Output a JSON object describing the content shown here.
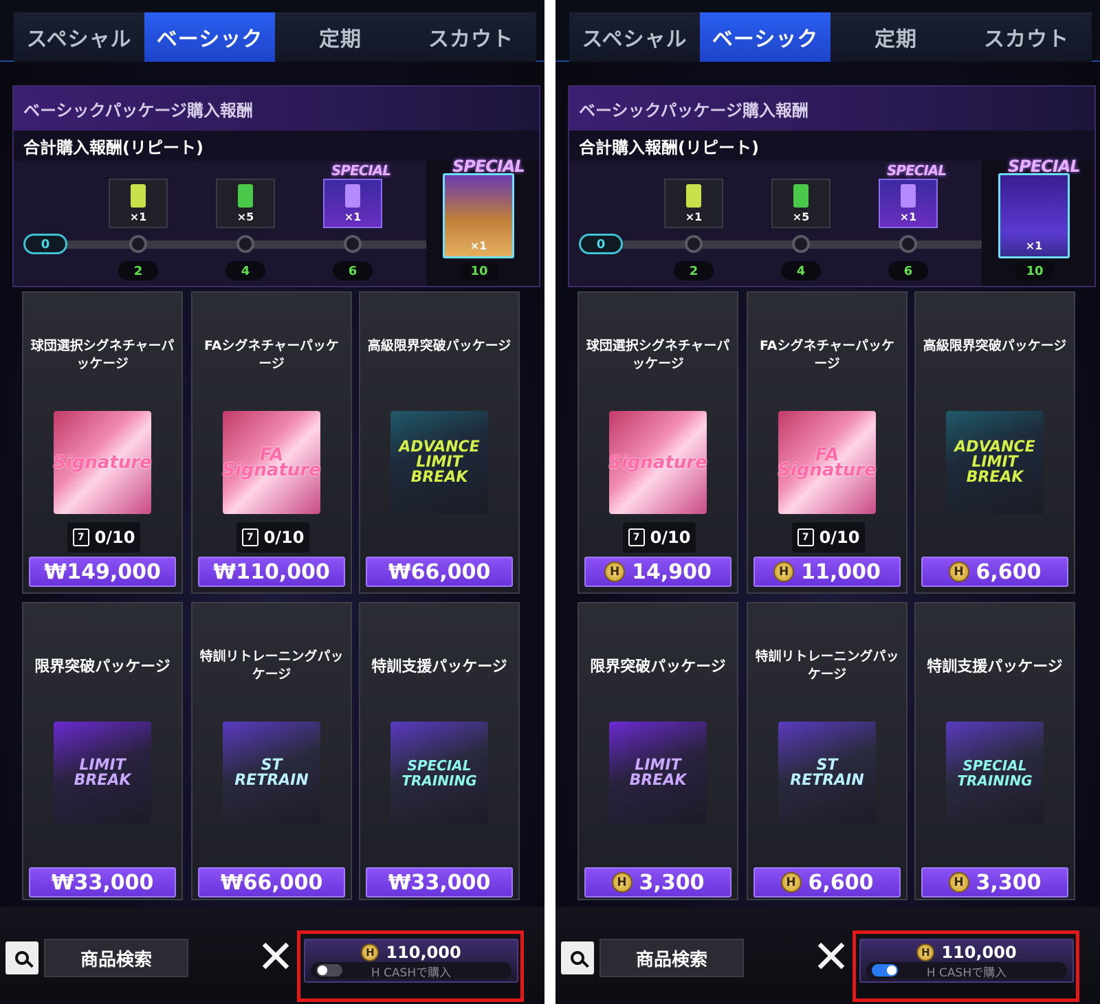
{
  "tabs": [
    "スペシャル",
    "ベーシック",
    "定期",
    "スカウト"
  ],
  "active_tab_index": 1,
  "rewards": {
    "header": "ベーシックパッケージ購入報酬",
    "subheader": "合計購入報酬(リピート)",
    "start_value": "0",
    "milestones": [
      {
        "label": "2",
        "reward_qty": "×1",
        "special": false
      },
      {
        "label": "4",
        "reward_qty": "×5",
        "special": false
      },
      {
        "label": "6",
        "reward_qty": "×1",
        "special": true,
        "badge": "SPECIAL"
      },
      {
        "label": "10",
        "reward_qty": "×1",
        "special": true,
        "badge": "SPECIAL"
      }
    ]
  },
  "products": [
    {
      "title": "球団選択シグネチャーパッケージ",
      "art_text": "Signature",
      "counter": "0/10"
    },
    {
      "title": "FAシグネチャーパッケージ",
      "art_text": "FA Signature",
      "counter": "0/10"
    },
    {
      "title": "高級限界突破パッケージ",
      "art_text": "ADVANCE LIMIT BREAK",
      "counter": ""
    },
    {
      "title": "限界突破パッケージ",
      "art_text": "LIMIT BREAK",
      "counter": ""
    },
    {
      "title": "特訓リトレーニングパッケージ",
      "art_text": "ST RETRAIN",
      "counter": ""
    },
    {
      "title": "特訓支援パッケージ",
      "art_text": "SPECIAL TRAINING",
      "counter": ""
    }
  ],
  "panels": {
    "left": {
      "prices": [
        "₩149,000",
        "₩110,000",
        "₩66,000",
        "₩33,000",
        "₩66,000",
        "₩33,000"
      ],
      "toggle_on": false
    },
    "right": {
      "prices": [
        "14,900",
        "11,000",
        "6,600",
        "3,300",
        "6,600",
        "3,300"
      ],
      "toggle_on": true
    }
  },
  "coin_glyph": "H",
  "bottom": {
    "search_label": "商品検索",
    "close_symbol": "✕",
    "hcash_amount": "110,000",
    "hcash_toggle_label": "H CASHで購入"
  },
  "colors": {
    "active_tab": "#2a5ef0",
    "price_button": "#7a44e8",
    "highlight": "#e41818",
    "milestone_text": "#5ee04d",
    "toggle_on": "#2a7af0"
  }
}
